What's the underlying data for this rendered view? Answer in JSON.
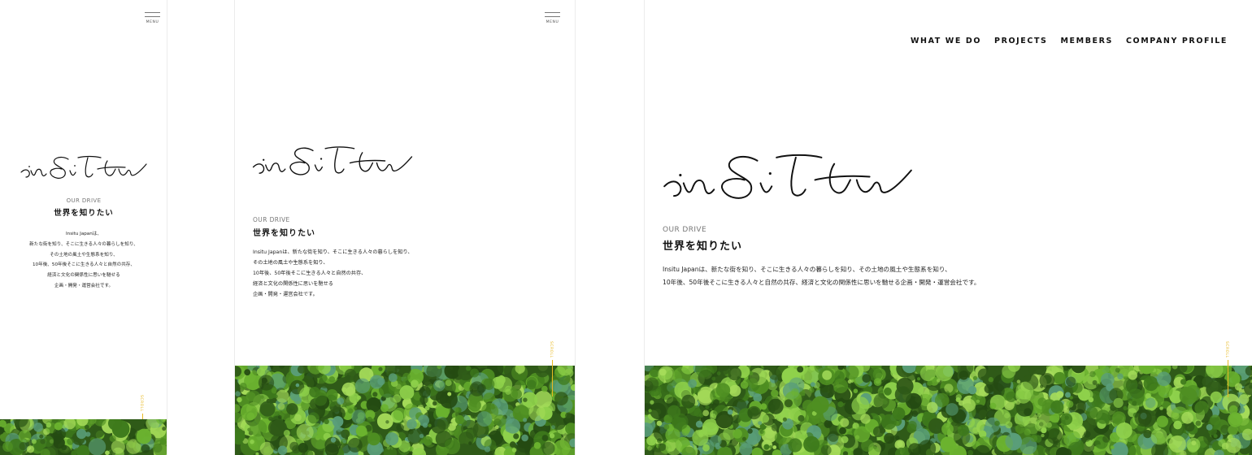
{
  "colors": {
    "accent": "#e8b923",
    "text": "#111111",
    "muted": "#777777",
    "forest_dark": "#2f5a18",
    "forest_mid": "#4f8f22",
    "forest_light": "#8fd14b"
  },
  "logo_text": "inSitu",
  "menu_label": "MENU",
  "scroll_label": "SCROLL",
  "nav": {
    "items": [
      {
        "label": "WHAT WE DO"
      },
      {
        "label": "PROJECTS"
      },
      {
        "label": "MEMBERS"
      },
      {
        "label": "COMPANY PROFILE"
      }
    ]
  },
  "drive": {
    "label": "OUR DRIVE",
    "title": "世界を知りたい",
    "mobile_lines": [
      "Insitu Japanは、",
      "新たな街を知り、そこに生きる人々の暮らしを知り、",
      "その土地の風土や生態系を知り、",
      "10年後、50年後そこに生きる人々と自然の共存、",
      "経済と文化の関係性に思いを馳せる",
      "企画・開発・運営会社です。"
    ],
    "tablet_lines": [
      "Insitu Japanは、新たな街を知り、そこに生きる人々の暮らしを知り、",
      "その土地の風土や生態系を知り、",
      "10年後、50年後そこに生きる人々と自然の共存、",
      "経済と文化の関係性に思いを馳せる",
      "企画・開発・運営会社です。"
    ],
    "desktop_lines": [
      "Insitu Japanは、新たな街を知り、そこに生きる人々の暮らしを知り、その土地の風土や生態系を知り、",
      "10年後、50年後そこに生きる人々と自然の共存、経済と文化の関係性に思いを馳せる企画・開発・運営会社です。"
    ]
  }
}
